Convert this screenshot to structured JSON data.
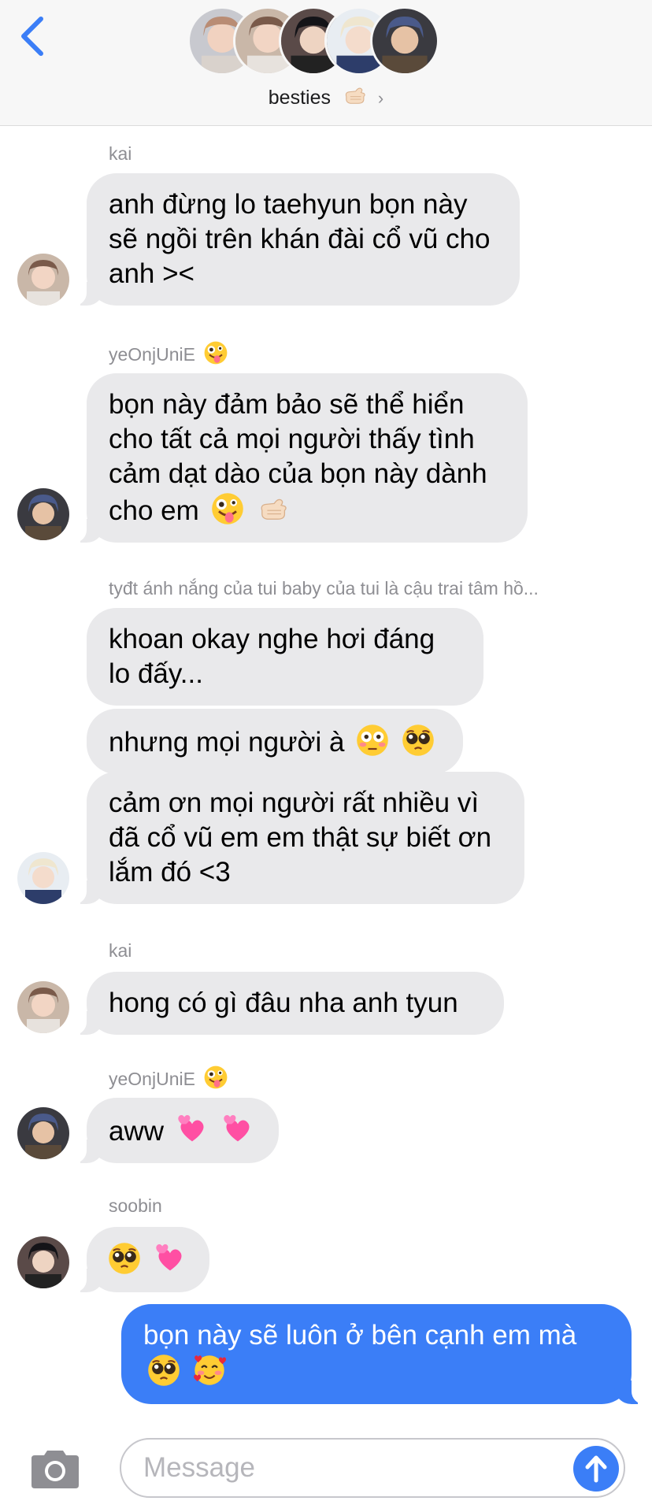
{
  "header": {
    "title": "besties",
    "title_emoji": "call-me-hand-emoji",
    "chevron": "›",
    "member_count": 5
  },
  "messages": [
    {
      "sender": "kai",
      "text": "anh đừng lo taehyun bọn này sẽ ngồi trên khán đài cổ vũ cho anh ><"
    },
    {
      "sender": "yeOnjUniE",
      "sender_emoji": "zany-face-emoji",
      "text": "bọn này đảm bảo sẽ thể hiển cho tất cả mọi người thấy tình cảm dạt dào của bọn này dành cho em",
      "emojis": [
        "zany-face-emoji",
        "call-me-hand-emoji"
      ]
    },
    {
      "sender": "tyđt ánh nắng của tui baby của tui là cậu trai tâm hồ...",
      "text1": "khoan okay nghe hơi đáng lo đấy...",
      "text2": "nhưng mọi người à",
      "text2_emojis": [
        "flushed-face-emoji",
        "pleading-face-emoji"
      ],
      "text3": "cảm ơn mọi người rất nhiều vì đã cổ vũ em em thật sự biết ơn lắm đó <3"
    },
    {
      "sender": "kai",
      "text": "hong có gì đâu nha anh tyun"
    },
    {
      "sender": "yeOnjUniE",
      "sender_emoji": "zany-face-emoji",
      "text": "aww",
      "emojis": [
        "two-hearts-emoji",
        "two-hearts-emoji"
      ]
    },
    {
      "sender": "soobin",
      "emojis": [
        "pleading-face-emoji",
        "two-hearts-emoji"
      ]
    },
    {
      "sender": "me",
      "text": "bọn này sẽ luôn ở bên cạnh em mà",
      "emojis": [
        "pleading-face-emoji",
        "smiling-face-with-hearts-emoji"
      ]
    }
  ],
  "input": {
    "placeholder": "Message"
  },
  "colors": {
    "accent": "#3b7ef7",
    "bubble_gray": "#e9e9eb",
    "sender_gray": "#8e8e93"
  }
}
